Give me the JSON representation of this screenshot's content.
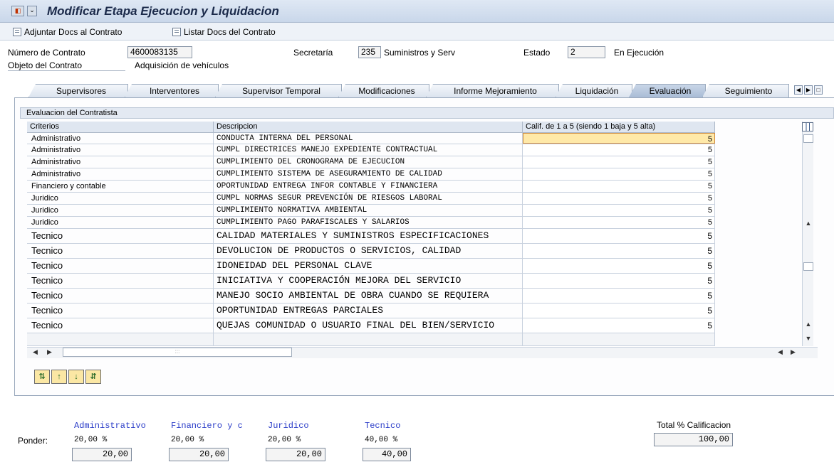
{
  "window": {
    "title": "Modificar Etapa Ejecucion y Liquidacion",
    "system_icon": "menu-icon",
    "menu_drop_glyph": "⌄"
  },
  "toolbar": {
    "attach_label": "Adjuntar Docs al Contrato",
    "list_label": "Listar Docs del Contrato"
  },
  "header": {
    "contract_number_label": "Número de Contrato",
    "contract_number": "4600083135",
    "secretaria_label": "Secretaría",
    "secretaria_code": "235",
    "secretaria_name": "Suministros y Serv",
    "estado_label": "Estado",
    "estado_code": "2",
    "estado_name": "En Ejecución",
    "objeto_label": "Objeto del Contrato",
    "objeto_value": "Adquisición de vehículos"
  },
  "tabs": [
    {
      "label": "Supervisores",
      "active": false
    },
    {
      "label": "Interventores",
      "active": false
    },
    {
      "label": "Supervisor Temporal",
      "active": false
    },
    {
      "label": "Modificaciones",
      "active": false
    },
    {
      "label": "Informe Mejoramiento",
      "active": false
    },
    {
      "label": "Liquidación",
      "active": false
    },
    {
      "label": "Evaluación",
      "active": true
    },
    {
      "label": "Seguimiento",
      "active": false
    }
  ],
  "group_title": "Evaluacion del Contratista",
  "grid": {
    "headers": [
      "Criterios",
      "Descripcion",
      "Calif. de 1 a 5 (siendo 1 baja y 5 alta)"
    ],
    "rows": [
      {
        "criterio": "Administrativo",
        "descripcion": "CONDUCTA INTERNA DEL PERSONAL",
        "calif": "5"
      },
      {
        "criterio": "Administrativo",
        "descripcion": "CUMPL DIRECTRICES MANEJO EXPEDIENTE CONTRACTUAL",
        "calif": "5"
      },
      {
        "criterio": "Administrativo",
        "descripcion": "CUMPLIMIENTO DEL CRONOGRAMA DE EJECUCION",
        "calif": "5"
      },
      {
        "criterio": "Administrativo",
        "descripcion": "CUMPLIMIENTO SISTEMA DE ASEGURAMIENTO DE CALIDAD",
        "calif": "5"
      },
      {
        "criterio": "Financiero y contable",
        "descripcion": "OPORTUNIDAD ENTREGA INFOR CONTABLE Y FINANCIERA",
        "calif": "5"
      },
      {
        "criterio": "Juridico",
        "descripcion": "CUMPL NORMAS SEGUR PREVENCIÓN DE RIESGOS LABORAL",
        "calif": "5"
      },
      {
        "criterio": "Juridico",
        "descripcion": "CUMPLIMIENTO NORMATIVA AMBIENTAL",
        "calif": "5"
      },
      {
        "criterio": "Juridico",
        "descripcion": "CUMPLIMIENTO PAGO PARAFISCALES Y SALARIOS",
        "calif": "5"
      },
      {
        "criterio": "Tecnico",
        "descripcion": "CALIDAD MATERIALES Y SUMINISTROS ESPECIFICACIONES",
        "calif": "5"
      },
      {
        "criterio": "Tecnico",
        "descripcion": "DEVOLUCION DE PRODUCTOS O SERVICIOS, CALIDAD",
        "calif": "5"
      },
      {
        "criterio": "Tecnico",
        "descripcion": "IDONEIDAD DEL PERSONAL CLAVE",
        "calif": "5"
      },
      {
        "criterio": "Tecnico",
        "descripcion": "INICIATIVA Y COOPERACIÓN MEJORA DEL SERVICIO",
        "calif": "5"
      },
      {
        "criterio": "Tecnico",
        "descripcion": "MANEJO SOCIO AMBIENTAL DE OBRA CUANDO SE REQUIERA",
        "calif": "5"
      },
      {
        "criterio": "Tecnico",
        "descripcion": "OPORTUNIDAD ENTREGAS PARCIALES",
        "calif": "5"
      },
      {
        "criterio": "Tecnico",
        "descripcion": "QUEJAS COMUNIDAD O USUARIO FINAL DEL BIEN/SERVICIO",
        "calif": "5"
      },
      {
        "criterio": "",
        "descripcion": "",
        "calif": ""
      }
    ],
    "selected_row": 0,
    "scroll_thumb_glyph": ":::"
  },
  "table_buttons": [
    "select-all-icon",
    "row-up-icon",
    "row-down-icon",
    "deselect-all-icon"
  ],
  "table_button_glyphs": [
    "⇅",
    "↑",
    "↓",
    "⇵"
  ],
  "ponderacion": {
    "label": "Ponder:",
    "categories": [
      {
        "name": "Administrativo",
        "pct_label": "20,00 %",
        "value": "20,00"
      },
      {
        "name": "Financiero y c",
        "pct_label": "20,00 %",
        "value": "20,00"
      },
      {
        "name": "Juridico",
        "pct_label": "20,00 %",
        "value": "20,00"
      },
      {
        "name": "Tecnico",
        "pct_label": "40,00 %",
        "value": "40,00"
      }
    ],
    "total_label": "Total % Calificacion",
    "total_value": "100,00"
  },
  "colors": {
    "category_text": "#2a3cc8",
    "selected_cell": "#ffe9a8",
    "active_tab": "#a9bcd6",
    "button_bg": "#fbe7a4"
  },
  "nav": {
    "left": "◀",
    "right": "▶",
    "up": "▲",
    "down": "▼",
    "first": "◀",
    "next": "▶",
    "more": "□"
  }
}
